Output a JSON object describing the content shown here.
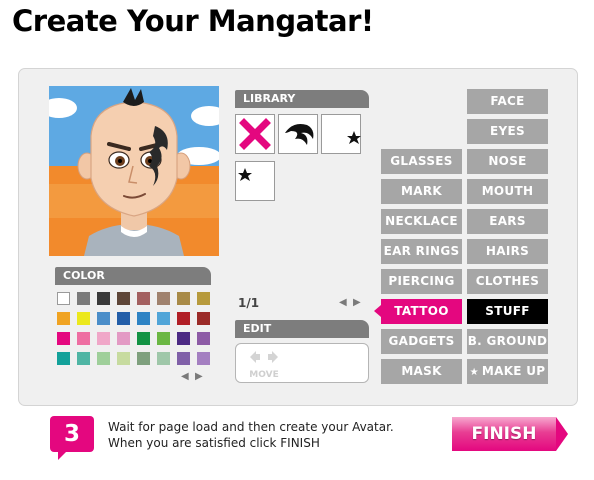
{
  "title": "Create Your Mangatar!",
  "library": {
    "header": "LIBRARY",
    "items": [
      {
        "icon": "remove-x-icon"
      },
      {
        "icon": "tribal-tattoo-icon"
      },
      {
        "icon": "star-tattoo-icon"
      },
      {
        "icon": "star-small-tattoo-icon"
      }
    ],
    "page_indicator": "1/1"
  },
  "edit": {
    "header": "EDIT",
    "move_label": "MOVE"
  },
  "color": {
    "header": "COLOR",
    "swatches": [
      [
        "#ffffff",
        "#7a7a7a",
        "#3a3a3a",
        "#5e4638",
        "#a36060",
        "#a0826e",
        "#a88a47",
        "#b79a3c"
      ],
      [
        "#f0a322",
        "#ece81d",
        "#4b8ec9",
        "#235ea8",
        "#2e83c4",
        "#51a5d8",
        "#b11f26",
        "#9b2b28"
      ],
      [
        "#e4077f",
        "#ee6ea2",
        "#f0a7c8",
        "#e39ac4",
        "#139344",
        "#6bb743",
        "#4c2a84",
        "#8d5ba6"
      ],
      [
        "#13a19a",
        "#4fb5a4",
        "#9fcf9a",
        "#c7db9f",
        "#7fa07e",
        "#9fc7a9",
        "#8060a8",
        "#a47fc1"
      ]
    ]
  },
  "categories": [
    {
      "label": "FACE",
      "state": "normal"
    },
    {
      "label": "EYES",
      "state": "normal"
    },
    {
      "label": "GLASSES",
      "state": "normal"
    },
    {
      "label": "NOSE",
      "state": "normal"
    },
    {
      "label": "MARK",
      "state": "normal"
    },
    {
      "label": "MOUTH",
      "state": "normal"
    },
    {
      "label": "NECKLACE",
      "state": "normal"
    },
    {
      "label": "EARS",
      "state": "normal"
    },
    {
      "label": "EAR RINGS",
      "state": "normal"
    },
    {
      "label": "HAIRS",
      "state": "normal"
    },
    {
      "label": "PIERCING",
      "state": "normal"
    },
    {
      "label": "CLOTHES",
      "state": "normal"
    },
    {
      "label": "TATTOO",
      "state": "selected"
    },
    {
      "label": "STUFF",
      "state": "group-active"
    },
    {
      "label": "GADGETS",
      "state": "normal"
    },
    {
      "label": "B. GROUND",
      "state": "normal"
    },
    {
      "label": "MASK",
      "state": "normal"
    },
    {
      "label": "MAKE UP",
      "state": "normal"
    }
  ],
  "makeup_star": "★",
  "instructions": {
    "step_number": "3",
    "line1": "Wait for page load and then create your Avatar.",
    "line2": "When you are satisfied click FINISH"
  },
  "finish_label": "FINISH",
  "colors": {
    "accent_pink": "#e4077f",
    "button_gray": "#a6a6a6",
    "panel_bg": "#f0f0f0"
  }
}
